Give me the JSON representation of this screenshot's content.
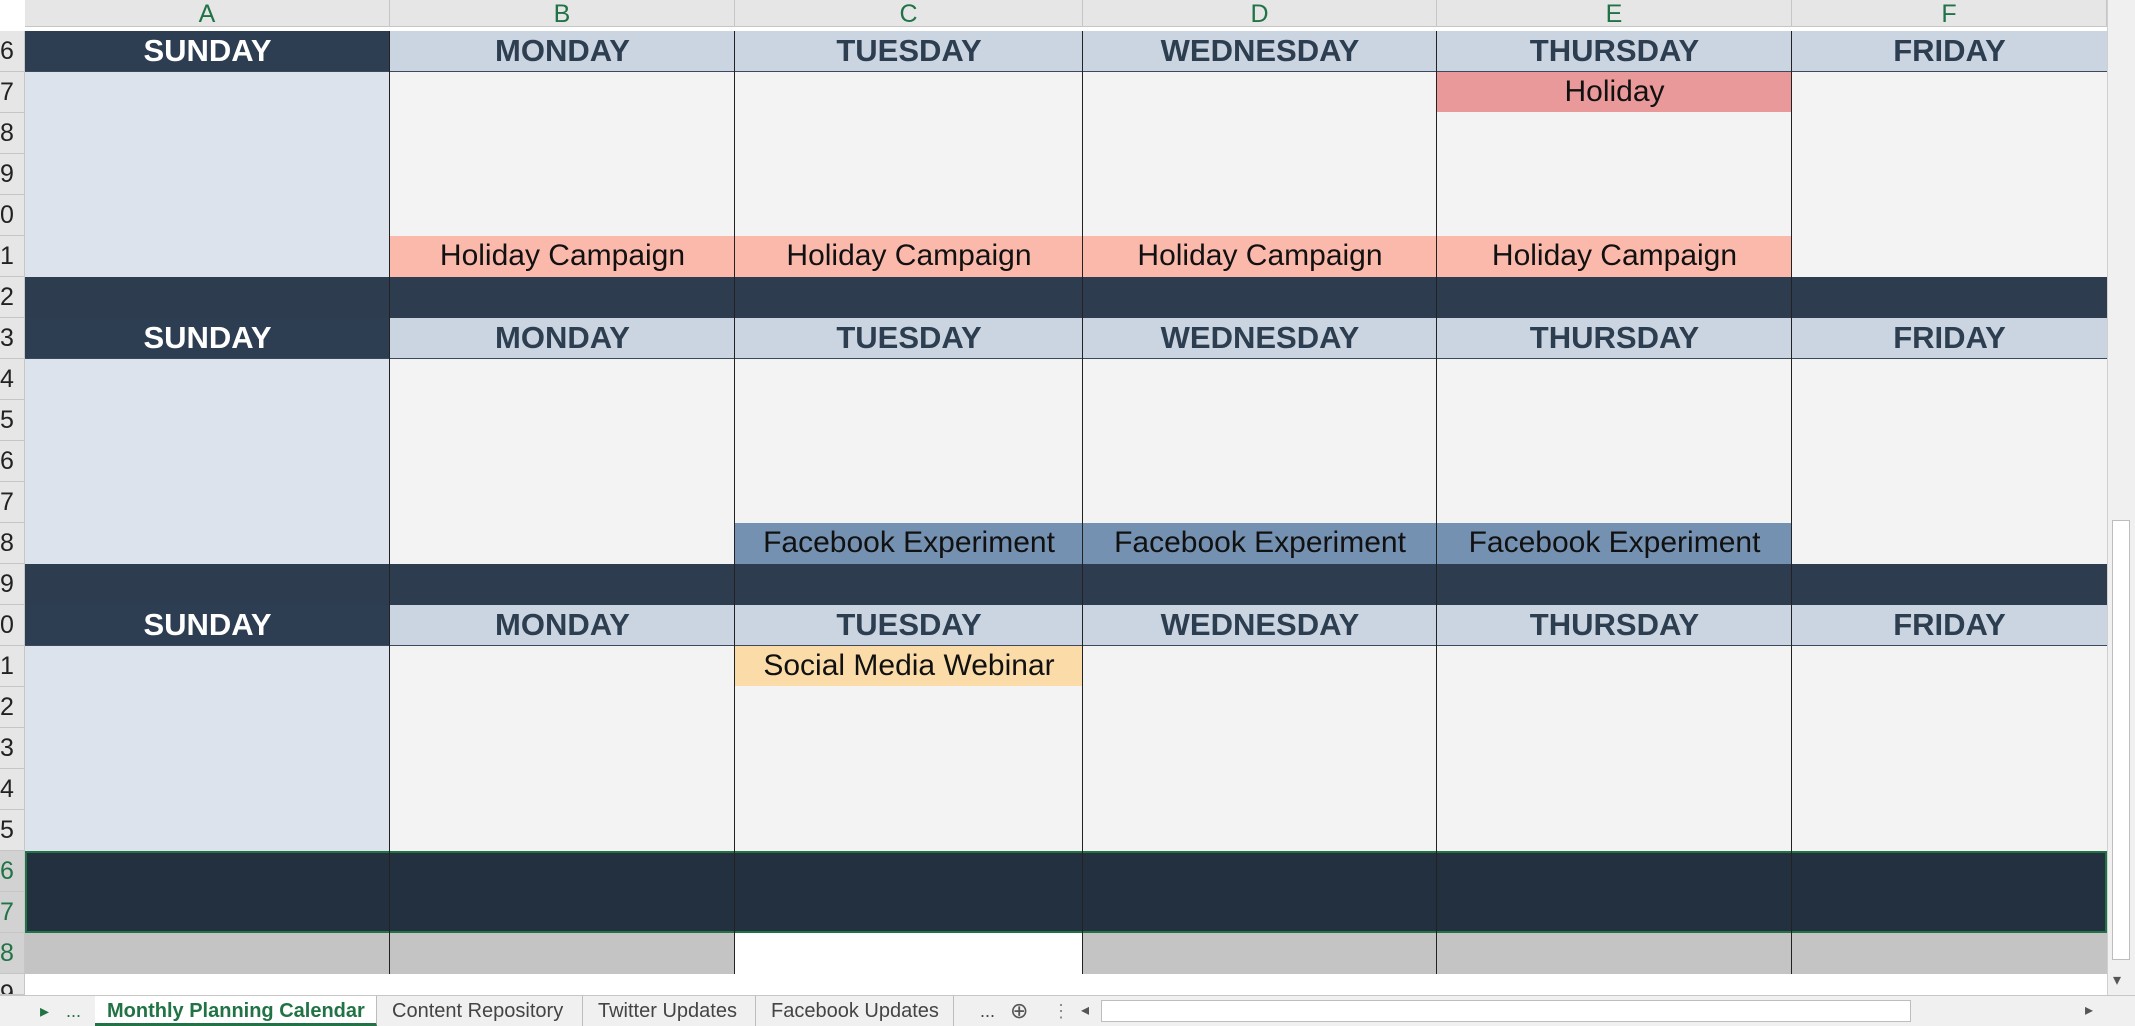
{
  "columns": [
    "A",
    "B",
    "C",
    "D",
    "E",
    "F"
  ],
  "row_numbers": [
    "6",
    "7",
    "8",
    "9",
    "0",
    "1",
    "2",
    "3",
    "4",
    "5",
    "6",
    "7",
    "8",
    "9",
    "0",
    "1",
    "2",
    "3",
    "4",
    "5",
    "6",
    "7",
    "8",
    "9"
  ],
  "days": [
    "SUNDAY",
    "MONDAY",
    "TUESDAY",
    "WEDNESDAY",
    "THURSDAY",
    "FRIDAY"
  ],
  "events": {
    "holiday": "Holiday",
    "holiday_campaign": "Holiday Campaign",
    "facebook_experiment": "Facebook Experiment",
    "social_media_webinar": "Social Media Webinar"
  },
  "colors": {
    "holiday": "#e99999",
    "holiday_campaign": "#fbb9ac",
    "facebook_experiment": "#7591b1",
    "social_media_webinar": "#fbdca9",
    "header_dark": "#2e3e52",
    "accent": "#217346"
  },
  "tabs": {
    "nav_next": "▸",
    "nav_more": "...",
    "active": "Monthly Planning Calendar",
    "content_repository": "Content Repository",
    "twitter_updates": "Twitter Updates",
    "facebook_updates": "Facebook Updates",
    "more": "...",
    "add": "⊕",
    "menu": "⋮"
  },
  "scroll": {
    "left": "◂",
    "right": "▸",
    "up": "▴",
    "down": "▾"
  }
}
